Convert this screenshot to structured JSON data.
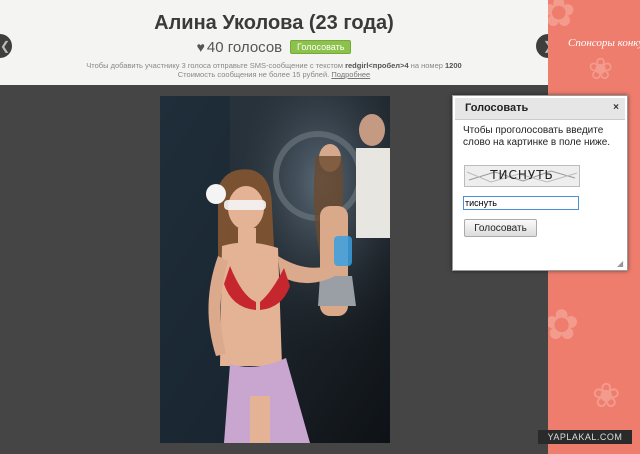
{
  "header": {
    "title": "Алина Уколова (23 года)",
    "votes_count": "40 голосов",
    "vote_button": "Голосовать",
    "sms_prefix": "Чтобы добавить участнику 3 голоса отправьте SMS-сообщение с текстом ",
    "sms_code": "redgirl<пробел>4",
    "sms_mid": " на номер ",
    "sms_number": "1200",
    "cost_text": "Стоимость сообщения не более 15 рублей. ",
    "cost_link": "Подробнее",
    "heart_icon": "heart-icon",
    "prev_icon": "chevron-left-icon",
    "next_icon": "chevron-right-icon"
  },
  "sponsor": {
    "title": "Спонсоры конкурса",
    "background": "#ee7d6e"
  },
  "dialog": {
    "title": "Голосовать",
    "close": "×",
    "text": "Чтобы проголосовать введите слово на картинке в поле ниже.",
    "captcha_text": "ТИСНУТЬ",
    "input_value": "тиснуть",
    "submit": "Голосовать"
  },
  "watermark": "YAPLAKAL.COM",
  "colors": {
    "vote_button": "#8cc14c",
    "page_background": "#454545",
    "header_background": "#f4f4f2"
  }
}
